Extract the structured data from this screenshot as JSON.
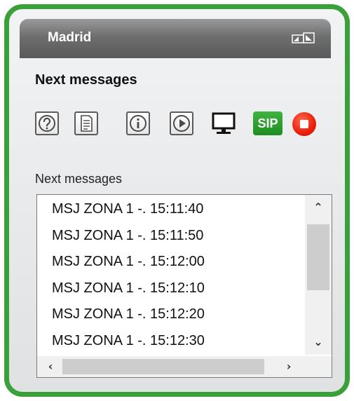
{
  "window": {
    "title": "Madrid",
    "subtitle": "Next messages"
  },
  "toolbar": {
    "icons": [
      "help-icon",
      "document-icon",
      "info-icon",
      "play-icon",
      "monitor-icon",
      "sip-icon",
      "stop-icon"
    ],
    "sip_label": "SIP"
  },
  "messages": {
    "label": "Next messages",
    "items": [
      "MSJ ZONA 1 -. 15:11:40",
      "MSJ ZONA 1 -. 15:11:50",
      "MSJ ZONA 1 -. 15:12:00",
      "MSJ ZONA 1 -. 15:12:10",
      "MSJ ZONA 1 -. 15:12:20",
      "MSJ ZONA 1 -. 15:12:30"
    ]
  },
  "colors": {
    "frame_border": "#3aa13a",
    "titlebar": "#6e6e6e",
    "sip_button": "#2a9e2e",
    "stop_button": "#ea1f0a"
  }
}
